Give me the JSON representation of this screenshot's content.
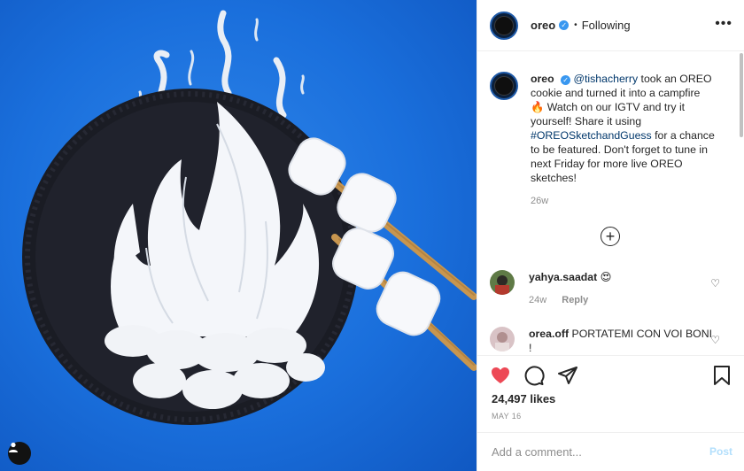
{
  "media": {
    "alt_icon": "person-icon"
  },
  "header": {
    "username": "oreo",
    "separator": "•",
    "follow_state": "Following",
    "more": "•••"
  },
  "caption": {
    "username": "oreo",
    "mention": "@tishacherry",
    "text1": " took an OREO cookie and turned it into a campfire 🔥 Watch on our IGTV and try it yourself! Share it using ",
    "hashtag": "#OREOSketchandGuess",
    "text2": " for a chance to be featured. Don't forget to tune in next Friday for more live OREO sketches!",
    "age": "26w"
  },
  "load_more_icon": "plus-circle-icon",
  "comments": [
    {
      "username": "yahya.saadat",
      "text": "😍",
      "age": "24w",
      "reply": "Reply"
    },
    {
      "username": "orea.off",
      "text": "PORTATEMI CON VOI BONI !"
    }
  ],
  "actions": {
    "like_icon": "heart-filled-icon",
    "comment_icon": "comment-icon",
    "share_icon": "share-icon",
    "save_icon": "bookmark-icon",
    "likes": "24,497 likes",
    "date": "MAY 16"
  },
  "add_comment": {
    "placeholder": "Add a comment...",
    "post_label": "Post"
  },
  "colors": {
    "background_blue": "#1a6fdc",
    "like_red": "#ed4956",
    "link": "#00376b",
    "verified": "#3897f0",
    "post_disabled": "#b2dffc"
  }
}
